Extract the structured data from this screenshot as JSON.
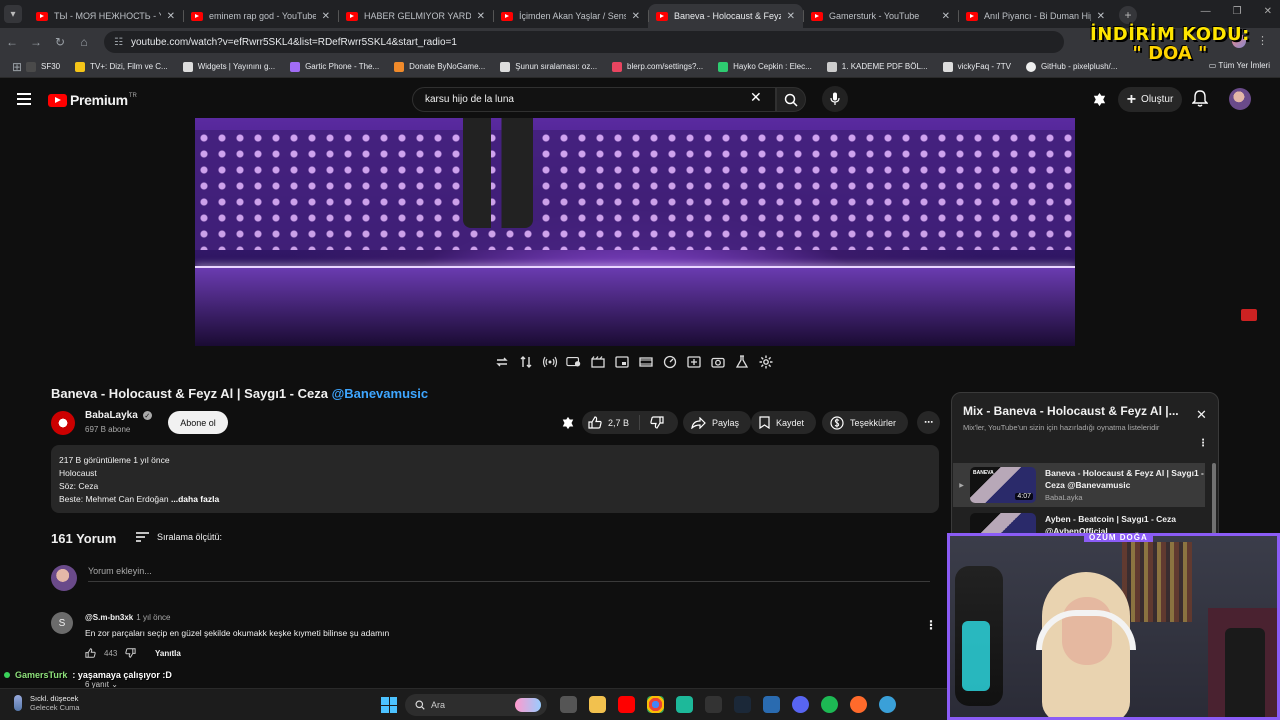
{
  "browser": {
    "tabs": [
      {
        "title": "ТЫ - МОЯ НЕЖНОСТЬ - YouT...",
        "active": false
      },
      {
        "title": "eminem rap god - YouTube",
        "active": false
      },
      {
        "title": "HABER GELMIYOR YARDAN KA...",
        "active": false
      },
      {
        "title": "İçimden Akan Yaşlar / Sensizce...",
        "active": false
      },
      {
        "title": "Baneva - Holocaust & Feyz Al |...",
        "active": true
      },
      {
        "title": "Gamersturk - YouTube",
        "active": false
      },
      {
        "title": "Anıl Piyancı - Bi Duman HipHo...",
        "active": false
      }
    ],
    "url": "youtube.com/watch?v=efRwrr5SKL4&list=RDefRwrr5SKL4&start_radio=1",
    "bookmarks": [
      {
        "label": "SF30",
        "color": "#4a4a4a"
      },
      {
        "label": "TV+: Dizi, Film ve C...",
        "color": "#f5c518"
      },
      {
        "label": "Widgets | Yayınını g...",
        "color": "#dddddd"
      },
      {
        "label": "Gartic Phone - The...",
        "color": "#a16cf5"
      },
      {
        "label": "Donate ByNoGame...",
        "color": "#f08a2a"
      },
      {
        "label": "Şunun sıralaması: oz...",
        "color": "#dddddd"
      },
      {
        "label": "blerp.com/settings?...",
        "color": "#e94560"
      },
      {
        "label": "Hayko Cepkin : Elec...",
        "color": "#2ecc71"
      },
      {
        "label": "1. KADEME PDF BÖL...",
        "color": "#cccccc"
      },
      {
        "label": "vickyFaq - 7TV",
        "color": "#dddddd"
      },
      {
        "label": "GitHub - pixelplush/...",
        "color": "#eeeeee"
      }
    ],
    "bookmarks_other": "Tüm Yer İmleri"
  },
  "promo": {
    "line1": "İNDİRİM KODU:",
    "line2": "\" DOA \""
  },
  "youtube": {
    "logo_text": "Premium",
    "logo_badge": "TR",
    "search_value": "karsu hijo de la luna",
    "create_label": "Oluştur"
  },
  "video": {
    "title": "Baneva - Holocaust & Feyz Al | Saygı1 - Ceza ",
    "title_tag": "@Banevamusic",
    "channel_name": "BabaLayka",
    "subscribers": "697 B abone",
    "subscribe_label": "Abone ol",
    "likes": "2,7 B",
    "share_label": "Paylaş",
    "save_label": "Kaydet",
    "thanks_label": "Teşekkürler",
    "desc_line1": "217 B görüntüleme  1 yıl önce",
    "desc_line2": "Holocaust",
    "desc_line3": "Söz: Ceza",
    "desc_line4": "Beste: Mehmet Can Erdoğan",
    "desc_more": "...daha fazla"
  },
  "comments": {
    "count_label": "161 Yorum",
    "sort_label": "Sıralama ölçütü:",
    "add_placeholder": "Yorum ekleyin...",
    "first": {
      "avatar_letter": "S",
      "author": "@S.m-bn3xk",
      "time": "1 yıl önce",
      "text": "En zor parçaları seçip en güzel şekilde okumakk keşke kıymeti bilinse şu adamın",
      "likes": "443",
      "reply_label": "Yanıtla",
      "replies_label": "6 yanıt"
    }
  },
  "playlist": {
    "title": "Mix - Baneva - Holocaust & Feyz Al |...",
    "subtitle": "Mix'ler, YouTube'un sizin için hazırladığı oynatma listeleridir",
    "items": [
      {
        "title": "Baneva - Holocaust & Feyz Al | Saygı1 - Ceza @Banevamusic",
        "channel": "BabaLayka",
        "duration": "4:07",
        "thumb_label": "BANEVA",
        "active": true
      },
      {
        "title": "Ayben - Beatcoin | Saygı1 - Ceza @AybenOfficial",
        "channel": "",
        "duration": "",
        "thumb_label": "",
        "active": false
      }
    ]
  },
  "stream": {
    "cam_label": "ÖZÜM DOĞA",
    "chat_user": "GamersTurk",
    "chat_message": ": yaşamaya çalışıyor :D"
  },
  "taskbar": {
    "weather_line1": "Sıckl. düşecek",
    "weather_line2": "Gelecek Cuma",
    "search_label": "Ara"
  },
  "colors": {
    "accent": "#3ea6ff",
    "youtube_red": "#ff0000",
    "cam_frame": "#8b5cf6",
    "promo": "#ffe600"
  }
}
